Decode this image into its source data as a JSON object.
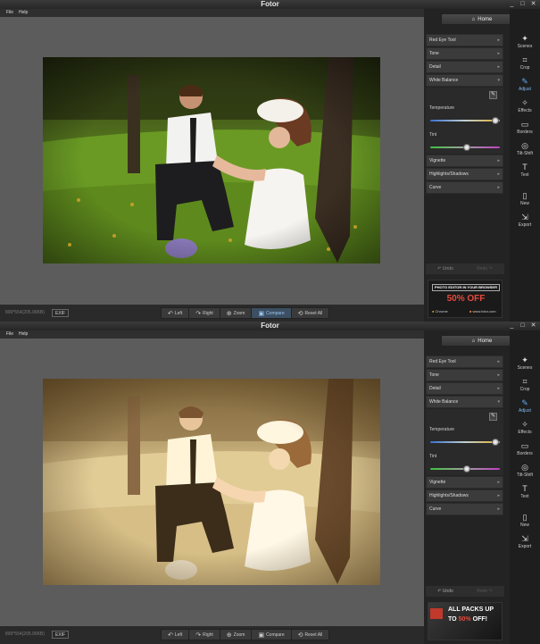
{
  "app": {
    "title": "Fotor",
    "window_controls": [
      "_",
      "□",
      "✕"
    ],
    "menu": [
      "File",
      "Help"
    ],
    "home_label": "Home",
    "adjustments": [
      "Red Eye Tool",
      "Tone",
      "Detail",
      "White Balance"
    ],
    "adjustments_after": [
      "Vignette",
      "Highlights/Shadows",
      "Curve"
    ],
    "white_balance": {
      "temperature_label": "Temperature",
      "tint_label": "Tint",
      "temperature_value": 0.93,
      "tint_value": 0.53
    },
    "undo_label": "Undo",
    "redo_label": "Redo",
    "sidebar_tools": [
      {
        "label": "Scenes",
        "icon": "scenes-icon",
        "glyph": "✦"
      },
      {
        "label": "Crop",
        "icon": "crop-icon",
        "glyph": "⌗"
      },
      {
        "label": "Adjust",
        "icon": "adjust-icon",
        "glyph": "✎"
      },
      {
        "label": "Effects",
        "icon": "effects-icon",
        "glyph": "✧"
      },
      {
        "label": "Borders",
        "icon": "borders-icon",
        "glyph": "▭"
      },
      {
        "label": "Tilt-Shift",
        "icon": "tilt-shift-icon",
        "glyph": "◎"
      },
      {
        "label": "Text",
        "icon": "text-icon",
        "glyph": "T"
      },
      {
        "label": "New",
        "icon": "new-icon",
        "glyph": "▯"
      },
      {
        "label": "Export",
        "icon": "export-icon",
        "glyph": "⇲"
      }
    ],
    "active_tool": "Adjust",
    "image_info": "899*554(205.99KB)",
    "exif_label": "EXIF",
    "toolbar": [
      {
        "label": "Left",
        "glyph": "↶"
      },
      {
        "label": "Right",
        "glyph": "↷"
      },
      {
        "label": "Zoom",
        "glyph": "⊕"
      },
      {
        "label": "Compare",
        "glyph": "▣"
      },
      {
        "label": "Reset All",
        "glyph": "⟲"
      }
    ],
    "active_toolbar": "Compare"
  },
  "ads": {
    "top": {
      "heading": "PHOTO EDITOR IN YOUR BROWSER",
      "offer": "50% OFF",
      "browser1": "Chrome",
      "browser2": "www.fotor.com"
    },
    "bottom": {
      "line1": "ALL PACKS UP",
      "line2": "TO",
      "offer": "50%",
      "line3": "OFF!"
    }
  },
  "colors": {
    "accent": "#5fa8f0",
    "ad_red": "#e8493c"
  }
}
